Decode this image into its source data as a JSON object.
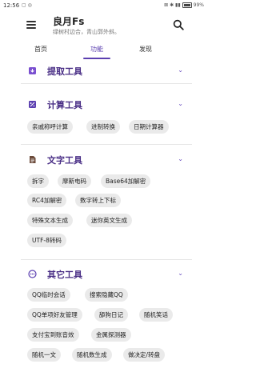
{
  "status": {
    "time": "12:56",
    "battery": "99%"
  },
  "app": {
    "title": "良月Fs",
    "subtitle": "绿树村边合，青山郭外斜。"
  },
  "tabs": [
    {
      "label": "首页",
      "active": false
    },
    {
      "label": "功能",
      "active": true
    },
    {
      "label": "发现",
      "active": false
    }
  ],
  "sections": {
    "lift": {
      "title": "提取工具"
    },
    "calc": {
      "title": "计算工具",
      "items": [
        "亲戚称呼计算",
        "进制转换",
        "日期计算器"
      ]
    },
    "text": {
      "title": "文字工具",
      "items": [
        "拆字",
        "摩斯电码",
        "Base64加解密",
        "RC4加解密",
        "数字转上下标",
        "特殊文本生成",
        "迷你英文生成",
        "UTF-8转码"
      ]
    },
    "other": {
      "title": "其它工具",
      "items": [
        "QQ临时会话",
        "搜索隐藏QQ",
        "QQ单项好友管理",
        "舔狗日记",
        "随机笑话",
        "支付宝到账音效",
        "金属探测器",
        "随机一文",
        "随机数生成",
        "做决定/转盘"
      ]
    }
  },
  "colors": {
    "accent": "#5b3fb0",
    "section_title": "#4a2f86",
    "chip_bg": "#eaeaea"
  }
}
